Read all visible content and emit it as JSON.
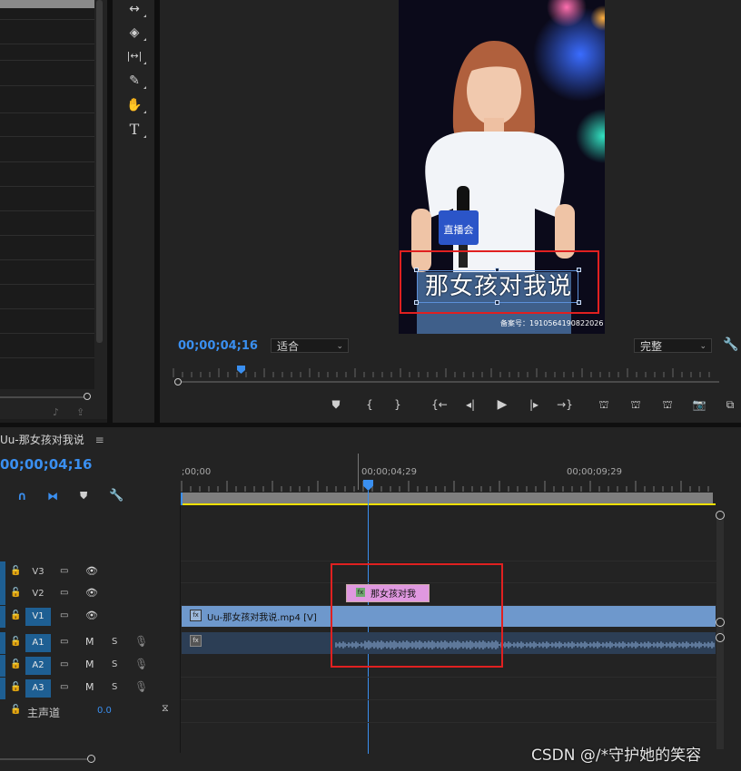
{
  "project_panel": {
    "bottom_icons": [
      "music-note-icon",
      "export-icon"
    ]
  },
  "tools": [
    {
      "name": "rate-stretch-tool",
      "glyph": "↔"
    },
    {
      "name": "razor-tool",
      "glyph": "◈"
    },
    {
      "name": "slip-tool",
      "glyph": "|↔|"
    },
    {
      "name": "pen-tool",
      "glyph": "✎"
    },
    {
      "name": "hand-tool",
      "glyph": "✋"
    },
    {
      "name": "type-tool",
      "glyph": "T"
    }
  ],
  "program_monitor": {
    "timecode": "00;00;04;16",
    "zoom_value": "适合",
    "quality_value": "完整",
    "caption_text": "那女孩对我说",
    "watermark_text": "备案号：1910564190822026",
    "badge_text": "直播会",
    "transport": [
      "add-marker",
      "mark-in",
      "mark-out",
      "go-to-in",
      "step-back",
      "play",
      "step-forward",
      "go-to-out",
      "insert",
      "overwrite",
      "lift",
      "export-frame",
      "button-editor"
    ]
  },
  "timeline": {
    "sequence_name": "Uu-那女孩对我说",
    "menu_glyph": "≡",
    "timecode": "00;00;04;16",
    "ruler_labels": [
      ";00;00",
      "00;00;04;29",
      "00;00;09;29"
    ],
    "video_tracks": [
      {
        "label": "V3",
        "targeted": false
      },
      {
        "label": "V2",
        "targeted": false
      },
      {
        "label": "V1",
        "targeted": true
      }
    ],
    "audio_tracks": [
      {
        "label": "A1",
        "m": "M",
        "s": "S"
      },
      {
        "label": "A2",
        "m": "M",
        "s": "S"
      },
      {
        "label": "A3",
        "m": "M",
        "s": "S"
      }
    ],
    "master": {
      "label": "主声道",
      "value": "0.0"
    },
    "clip_v1": "Uu-那女孩对我说.mp4 [V]",
    "clip_v2": "那女孩对我",
    "fx_label": "fx"
  },
  "watermark": "CSDN @/*守护她的笑容",
  "colors": {
    "accent_blue": "#3a8ff0",
    "highlight_red": "#e02020",
    "clip_blue": "#6e98cc",
    "title_pink": "#e098e0",
    "track_target_blue": "#1e5f93"
  }
}
